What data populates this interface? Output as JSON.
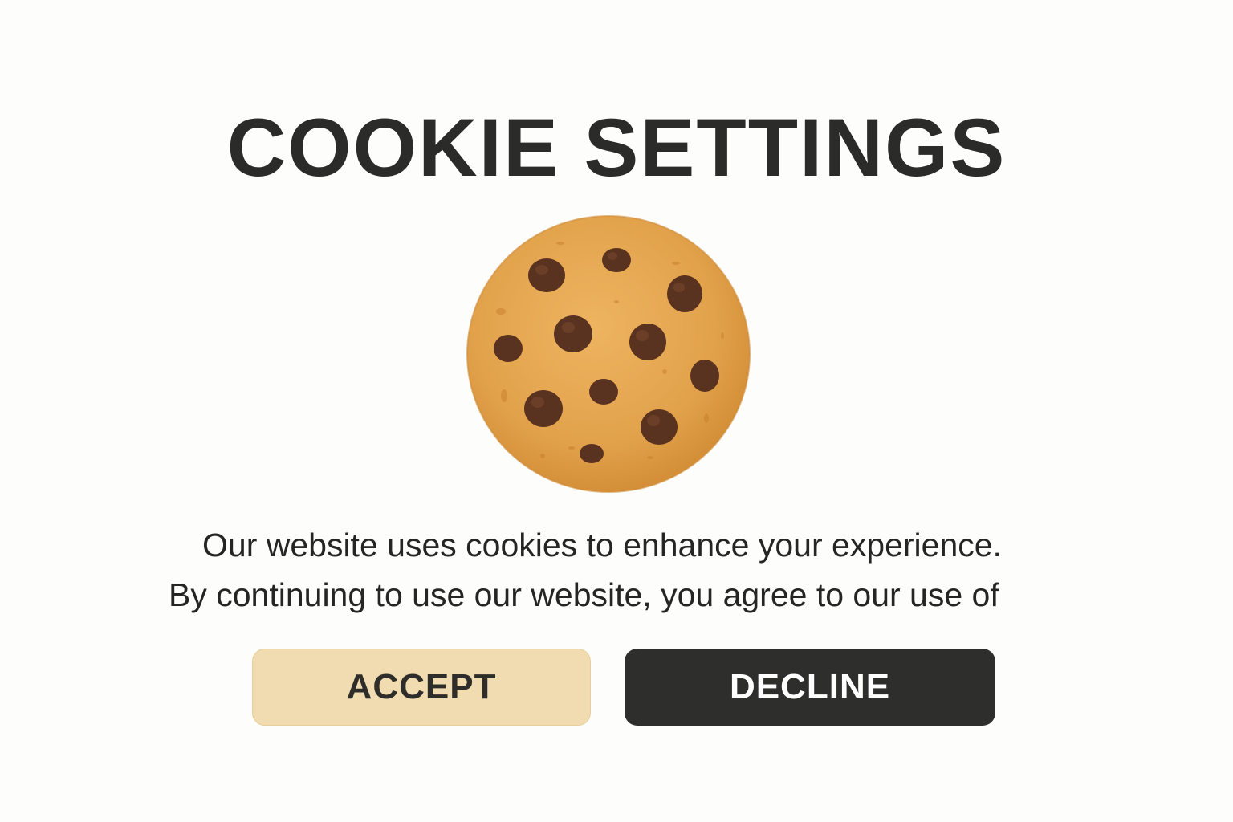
{
  "dialog": {
    "title": "COOKIE SETTINGS",
    "illustration": "chocolate-chip-cookie-icon",
    "message_line1": "Our website uses cookies to enhance your experience.",
    "message_line2": "By continuing to use our website, you agree to our use of"
  },
  "buttons": {
    "accept_label": "ACCEPT",
    "decline_label": "DECLINE"
  },
  "colors": {
    "background": "#fdfdfb",
    "title_text": "#2b2b29",
    "accept_bg": "#f1dcb1",
    "decline_bg": "#2e2f2c",
    "decline_text": "#ffffff",
    "cookie_dough": "#e2a24c",
    "chocolate_chip": "#5a3220"
  }
}
